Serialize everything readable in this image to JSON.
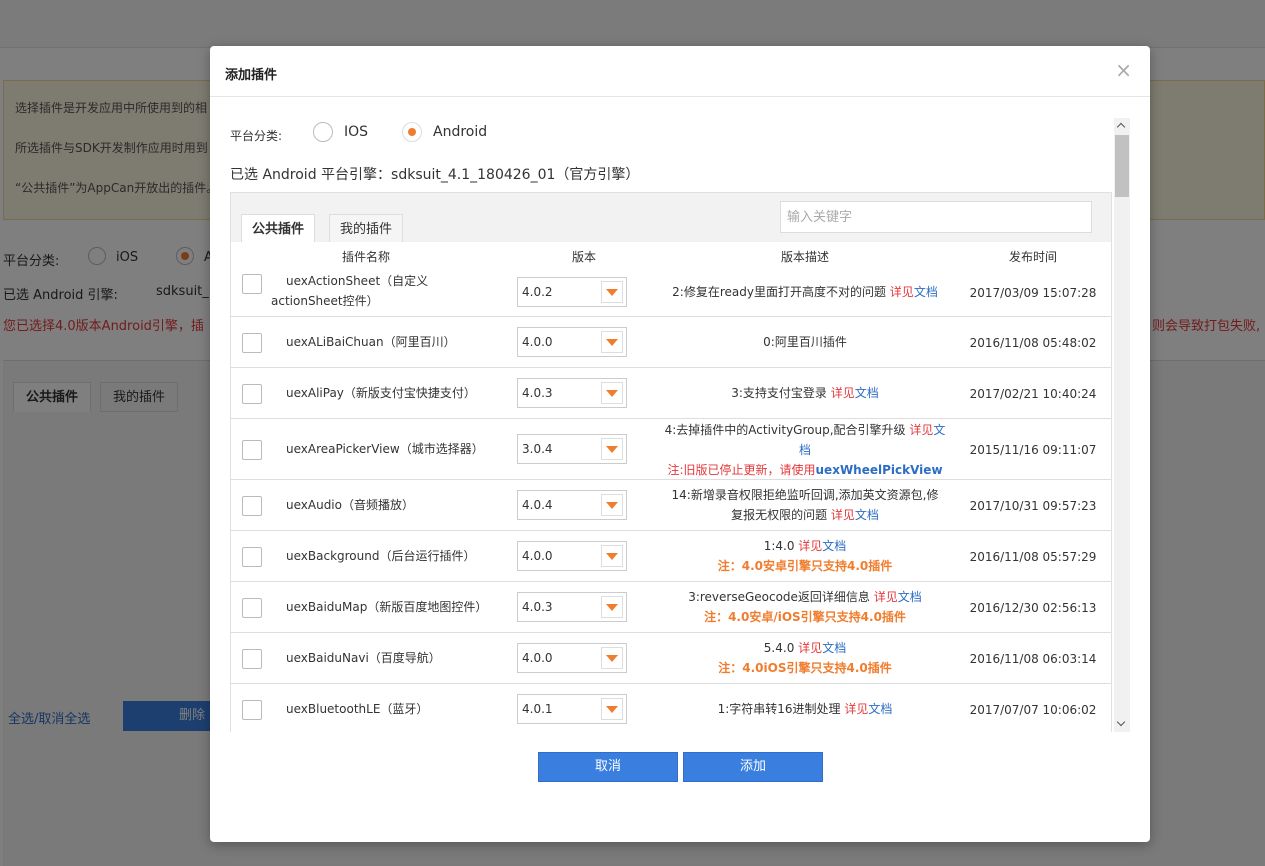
{
  "background": {
    "notice_lines": [
      "选择插件是开发应用中所使用到的相",
      "所选插件与SDK开发制作应用时用到",
      "“公共插件”为AppCan开放出的插件。"
    ],
    "platform_label": "平台分类:",
    "ios_label": "iOS",
    "android_initial": "A",
    "engine_label": "已选 Android 引擎:",
    "engine_value": "sdksuit_",
    "warning_left": "您已选择4.0版本Android引擎，插",
    "warning_right": "则会导致打包失败,",
    "tab_public": "公共插件",
    "tab_mine": "我的插件",
    "select_all": "全选/取消全选",
    "delete_button": "删除"
  },
  "modal": {
    "title": "添加插件",
    "close_glyph": "×",
    "platform_label": "平台分类:",
    "platform_options": [
      {
        "label": "IOS",
        "selected": false
      },
      {
        "label": "Android",
        "selected": true
      }
    ],
    "engine_line": "已选 Android 平台引擎：sdksuit_4.1_180426_01（官方引擎）",
    "tabs": [
      {
        "label": "公共插件",
        "active": true
      },
      {
        "label": "我的插件",
        "active": false
      }
    ],
    "search": {
      "placeholder": "输入关键字",
      "value": ""
    },
    "columns": {
      "name": "插件名称",
      "version": "版本",
      "description": "版本描述",
      "time": "发布时间"
    },
    "rows": [
      {
        "name": "uexActionSheet（自定义actionSheet控件）",
        "version": "4.0.2",
        "desc_text": "2:修复在ready里面打开高度不对的问题",
        "link_detail": "详见",
        "link_doc": "文档",
        "time": "2017/03/09 15:07:28"
      },
      {
        "name": "uexALiBaiChuan（阿里百川）",
        "version": "4.0.0",
        "desc_text": "0:阿里百川插件",
        "time": "2016/11/08 05:48:02"
      },
      {
        "name": "uexAliPay（新版支付宝快捷支付）",
        "version": "4.0.3",
        "desc_text": "3:支持支付宝登录",
        "link_detail": "详见",
        "link_doc": "文档",
        "time": "2017/02/21 10:40:24"
      },
      {
        "name": "uexAreaPickerView（城市选择器）",
        "version": "3.0.4",
        "desc_text": "4:去掉插件中的ActivityGroup,配合引擎升级",
        "link_detail": "详见",
        "link_doc": "文档",
        "notice_prefix": "注:旧版已停止更新，请使用",
        "notice_link": "uexWheelPickView",
        "time": "2015/11/16 09:11:07"
      },
      {
        "name": "uexAudio（音频播放）",
        "version": "4.0.4",
        "desc_text": "14:新增录音权限拒绝监听回调,添加英文资源包,修复报无权限的问题",
        "link_detail": "详见",
        "link_doc": "文档",
        "time": "2017/10/31 09:57:23"
      },
      {
        "name": "uexBackground（后台运行插件）",
        "version": "4.0.0",
        "desc_text": "1:4.0",
        "link_detail": "详见",
        "link_doc": "文档",
        "notice": "注：4.0安卓引擎只支持4.0插件",
        "time": "2016/11/08 05:57:29"
      },
      {
        "name": "uexBaiduMap（新版百度地图控件）",
        "version": "4.0.3",
        "desc_text": "3:reverseGeocode返回详细信息",
        "link_detail": "详见",
        "link_doc": "文档",
        "notice": "注：4.0安卓/iOS引擎只支持4.0插件",
        "time": "2016/12/30 02:56:13"
      },
      {
        "name": "uexBaiduNavi（百度导航）",
        "version": "4.0.0",
        "desc_text": "5.4.0",
        "link_detail": "详见",
        "link_doc": "文档",
        "notice": "注：4.0iOS引擎只支持4.0插件",
        "time": "2016/11/08 06:03:14"
      },
      {
        "name": "uexBluetoothLE（蓝牙）",
        "version": "4.0.1",
        "desc_text": "1:字符串转16进制处理",
        "link_detail": "详见",
        "link_doc": "文档",
        "time": "2017/07/07 10:06:02"
      }
    ],
    "buttons": {
      "cancel": "取消",
      "add": "添加"
    }
  },
  "colors": {
    "accent_orange": "#f07d2e",
    "primary_blue": "#3a7fe0",
    "link_red": "#e4393c",
    "link_blue": "#2d6dc4"
  }
}
